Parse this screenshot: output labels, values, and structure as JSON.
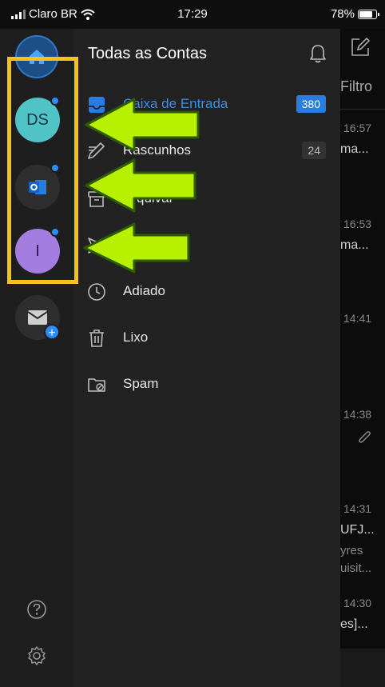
{
  "status_bar": {
    "carrier": "Claro BR",
    "time": "17:29",
    "battery": "78%"
  },
  "rail": {
    "accounts": [
      {
        "initials": "DS",
        "color": "#4fc3c6"
      },
      {
        "initials": "",
        "icon": "outlook-icon"
      },
      {
        "initials": "I",
        "color": "#a57ce0"
      }
    ]
  },
  "drawer": {
    "title": "Todas as Contas",
    "folders": [
      {
        "label": "Caixa de Entrada",
        "count": "380",
        "icon": "inbox-icon",
        "active": true
      },
      {
        "label": "Rascunhos",
        "count": "24",
        "icon": "drafts-icon"
      },
      {
        "label": "Arquivar",
        "count": "",
        "icon": "archive-icon"
      },
      {
        "label": "",
        "count": "",
        "icon": "sent-icon"
      },
      {
        "label": "Adiado",
        "count": "",
        "icon": "clock-icon"
      },
      {
        "label": "Lixo",
        "count": "",
        "icon": "trash-icon"
      },
      {
        "label": "Spam",
        "count": "",
        "icon": "spam-folder-icon"
      }
    ]
  },
  "behind": {
    "filter_label": "Filtro",
    "times": [
      "16:57",
      "16:53",
      "14:41",
      "14:38",
      "14:31",
      "14:30"
    ],
    "snippets": [
      "ma...",
      "ma...",
      "UFJ...",
      "es]..."
    ],
    "gray_snippets": [
      "yres",
      "uisit..."
    ]
  },
  "colors": {
    "accent": "#2a8cff",
    "highlight": "#f6c21a",
    "arrow": "#b7f000"
  }
}
